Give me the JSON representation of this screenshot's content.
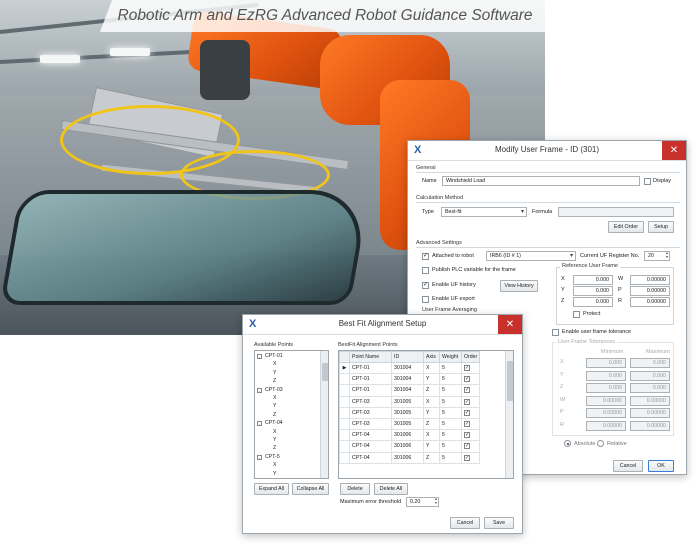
{
  "caption": "Robotic Arm and EzRG Advanced Robot Guidance Software",
  "colors": {
    "close_button": "#c8312b",
    "robot": "#e0520f",
    "window_border": "#9ea6ad"
  },
  "frame_window": {
    "title": "Modify User Frame - ID (301)",
    "general_label": "General",
    "name_label": "Name",
    "name_value": "Windshield Load",
    "display_check_label": "Display",
    "calc_method_label": "Calculation Method",
    "type_label": "Type",
    "type_value": "Best-fit",
    "formula_label": "Formula",
    "edit_order_btn": "Edit Order",
    "setup_btn": "Setup",
    "advanced_label": "Advanced Settings",
    "attached_label": "Attached to robot",
    "attached_value": "IRB6 (ID # 1)",
    "register_label": "Current UF Register No.",
    "register_value": "20",
    "publish_label": "Publish PLC variable for the frame",
    "history_label": "Enable UF history",
    "view_history_btn": "View History",
    "export_label": "Enable UF export",
    "averaging_label": "User Frame Averaging",
    "ref_frame_label": "Reference User Frame",
    "ref_rows": [
      {
        "l1": "X",
        "v1": "0.000",
        "l2": "W",
        "v2": "0.00000"
      },
      {
        "l1": "Y",
        "v1": "0.000",
        "l2": "P",
        "v2": "0.00000"
      },
      {
        "l1": "Z",
        "v1": "0.000",
        "l2": "R",
        "v2": "0.00000"
      }
    ],
    "protect_label": "Protect",
    "tolerance_label": "Enable user frame tolerance",
    "tolerances_group": "User Frame Tolerances",
    "min_label": "Minimum",
    "max_label": "Maximum",
    "tol_rows": [
      {
        "axis": "X",
        "min": "0.000",
        "max": "0.000"
      },
      {
        "axis": "Y",
        "min": "0.000",
        "max": "0.000"
      },
      {
        "axis": "Z",
        "min": "0.000",
        "max": "0.000"
      },
      {
        "axis": "W",
        "min": "0.00000",
        "max": "0.00000"
      },
      {
        "axis": "P",
        "min": "0.00000",
        "max": "0.00000"
      },
      {
        "axis": "R",
        "min": "0.00000",
        "max": "0.00000"
      }
    ],
    "absolute_label": "Absolute",
    "relative_label": "Relative",
    "cancel_btn": "Cancel",
    "ok_btn": "OK"
  },
  "bestfit_window": {
    "title": "Best Fit Alignment Setup",
    "available_label": "Available Points",
    "tree": [
      {
        "text": "CPT-01",
        "level": 0,
        "node": "-"
      },
      {
        "text": "X",
        "level": 1
      },
      {
        "text": "Y",
        "level": 1
      },
      {
        "text": "Z",
        "level": 1
      },
      {
        "text": "CPT-03",
        "level": 0,
        "node": "-"
      },
      {
        "text": "X",
        "level": 1
      },
      {
        "text": "Y",
        "level": 1
      },
      {
        "text": "Z",
        "level": 1
      },
      {
        "text": "CPT-04",
        "level": 0,
        "node": "-"
      },
      {
        "text": "X",
        "level": 1
      },
      {
        "text": "Y",
        "level": 1
      },
      {
        "text": "Z",
        "level": 1
      },
      {
        "text": "CPT-5",
        "level": 0,
        "node": "-"
      },
      {
        "text": "X",
        "level": 1
      },
      {
        "text": "Y",
        "level": 1
      }
    ],
    "expand_btn": "Expand All",
    "collapse_btn": "Collapse All",
    "points_label": "BestFit Alignment Points",
    "columns": [
      "Point Name",
      "ID",
      "Axis",
      "Weight",
      "Order"
    ],
    "rows": [
      {
        "name": "CPT-01",
        "id": "301004",
        "axis": "X",
        "weight": "5",
        "order": "✓"
      },
      {
        "name": "CPT-01",
        "id": "301004",
        "axis": "Y",
        "weight": "5",
        "order": "✓"
      },
      {
        "name": "CPT-01",
        "id": "301004",
        "axis": "Z",
        "weight": "5",
        "order": "✓"
      },
      {
        "name": "CPT-03",
        "id": "301005",
        "axis": "X",
        "weight": "5",
        "order": "✓"
      },
      {
        "name": "CPT-03",
        "id": "301005",
        "axis": "Y",
        "weight": "5",
        "order": "✓"
      },
      {
        "name": "CPT-03",
        "id": "301005",
        "axis": "Z",
        "weight": "5",
        "order": "✓"
      },
      {
        "name": "CPT-04",
        "id": "301006",
        "axis": "X",
        "weight": "5",
        "order": "✓"
      },
      {
        "name": "CPT-04",
        "id": "301006",
        "axis": "Y",
        "weight": "5",
        "order": "✓"
      },
      {
        "name": "CPT-04",
        "id": "301006",
        "axis": "Z",
        "weight": "5",
        "order": "✓"
      }
    ],
    "delete_btn": "Delete",
    "delete_all_btn": "Delete All",
    "max_error_label": "Maximum error threshold",
    "max_error_value": "0.20",
    "cancel_btn": "Cancel",
    "save_btn": "Save"
  }
}
